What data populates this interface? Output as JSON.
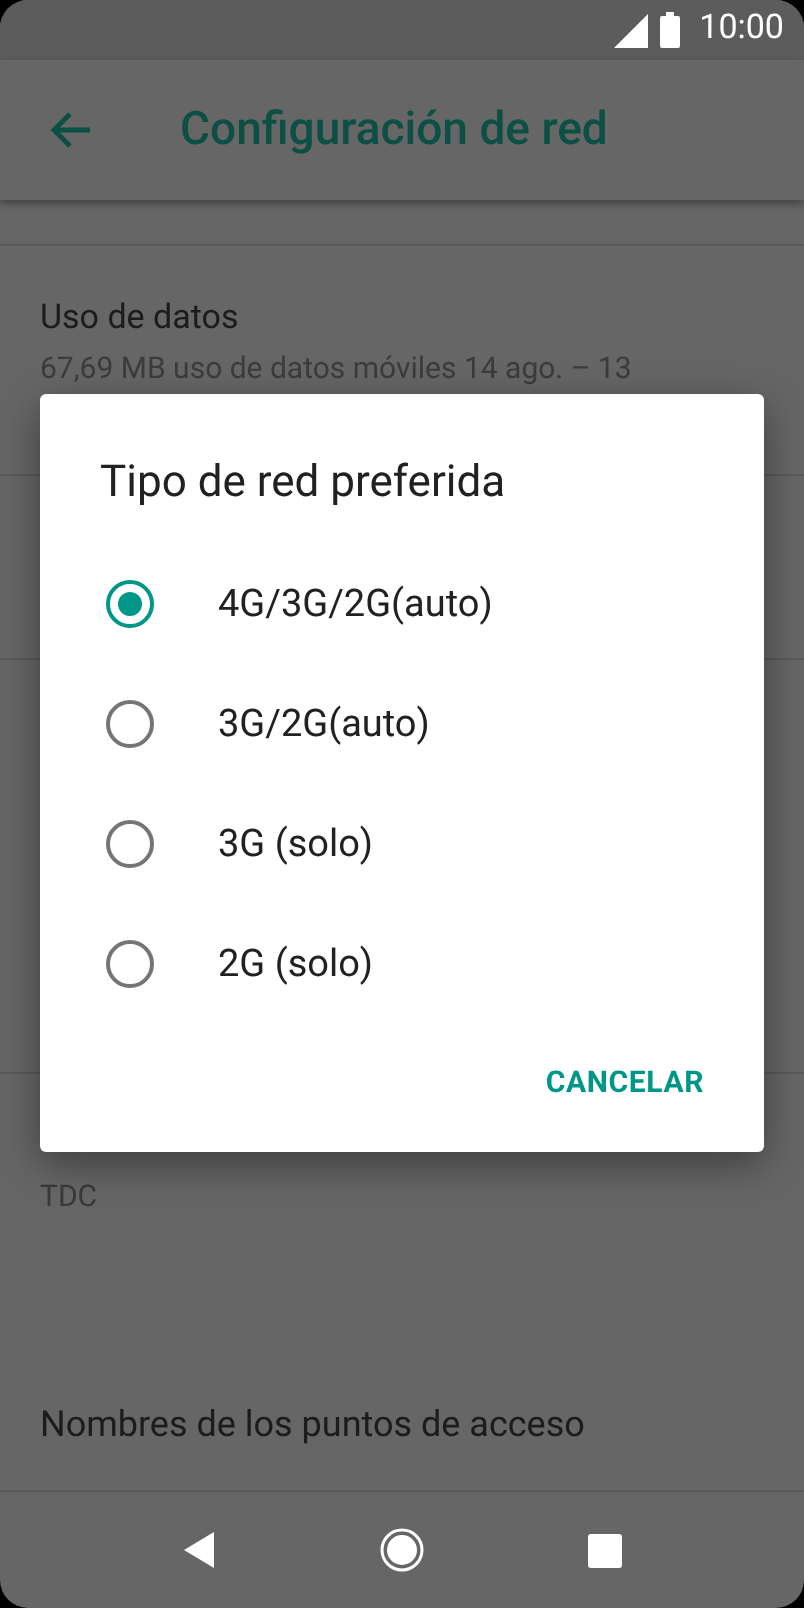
{
  "status_bar": {
    "time": "10:00"
  },
  "app_bar": {
    "title": "Configuración de red"
  },
  "settings": [
    {
      "title": "Uso de datos",
      "subtitle": "67,69 MB uso de datos móviles 14 ago. – 13"
    }
  ],
  "tdc_item": {
    "subtitle": "TDC"
  },
  "apn_item": {
    "title": "Nombres de los puntos de acceso"
  },
  "dialog": {
    "title": "Tipo de red preferida",
    "options": [
      {
        "label": "4G/3G/2G(auto)",
        "selected": true
      },
      {
        "label": "3G/2G(auto)",
        "selected": false
      },
      {
        "label": "3G (solo)",
        "selected": false
      },
      {
        "label": "2G (solo)",
        "selected": false
      }
    ],
    "button": "CANCELAR"
  }
}
